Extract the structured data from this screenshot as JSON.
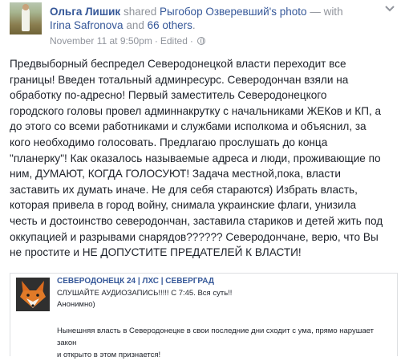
{
  "post": {
    "author": "Ольга Лишик",
    "action": "shared",
    "source_author": "Рыгобор Озверевший's",
    "source_object": "photo",
    "with_word": "— with",
    "tagged_person": "Irina Safronova",
    "and_word": "and",
    "others_link": "66 others",
    "period": ".",
    "timestamp": "November 11 at 9:50pm",
    "separator": "·",
    "edited": "Edited",
    "separator2": "·",
    "privacy_icon": "globe-icon",
    "text": "Предвыборный беспредел Северодонецкой власти переходит все\nграницы! Введен тотальный админресурс. Северодончан взяли на\nобработку по-адресно! Первый заместитель Северодонецкого\nгородского головы провел админнакрутку с начальниками ЖЕКов и КП, а\nдо этого со всеми работниками и службами исполкома и объяснил, за\nкого необходимо голосовать. Предлагаю прослушать до конца\n\"планерку\"! Как оказалось называемые адреса и люди, проживающие по\nним, ДУМАЮТ, КОГДА ГОЛОСУЮТ! Задача местной,пока, власти\nзаставить их думать иначе. Не для себя стараются) Избрать власть,\nкоторая привела в город войну, снимала украинские флаги, унизила\nчесть и достоинство северодончан, заставила стариков и детей жить под\nоккупацией и разрывами снарядов?????? Северодончане, верю, что Вы\nне простите и НЕ ДОПУСТИТЕ ПРЕДАТЕЛЕЙ К ВЛАСТИ!"
  },
  "shared": {
    "title": "СЕВЕРОДОНЕЦК 24 | ЛХС | СЕВЕРГРАД",
    "subtitle": "СЛУШАЙТЕ АУДИОЗАПИСЬ!!!!! С 7:45. Вся суть!!\nАнонимно)",
    "text": "Нынешняя власть в Северодонецке в свои последние дни сходит с ума, прямо нарушает закон\nи открыто в этом признается!"
  },
  "icons": {
    "options": "chevron-down-icon"
  },
  "colors": {
    "link": "#365899",
    "meta": "#90949c",
    "text": "#1d2129"
  }
}
